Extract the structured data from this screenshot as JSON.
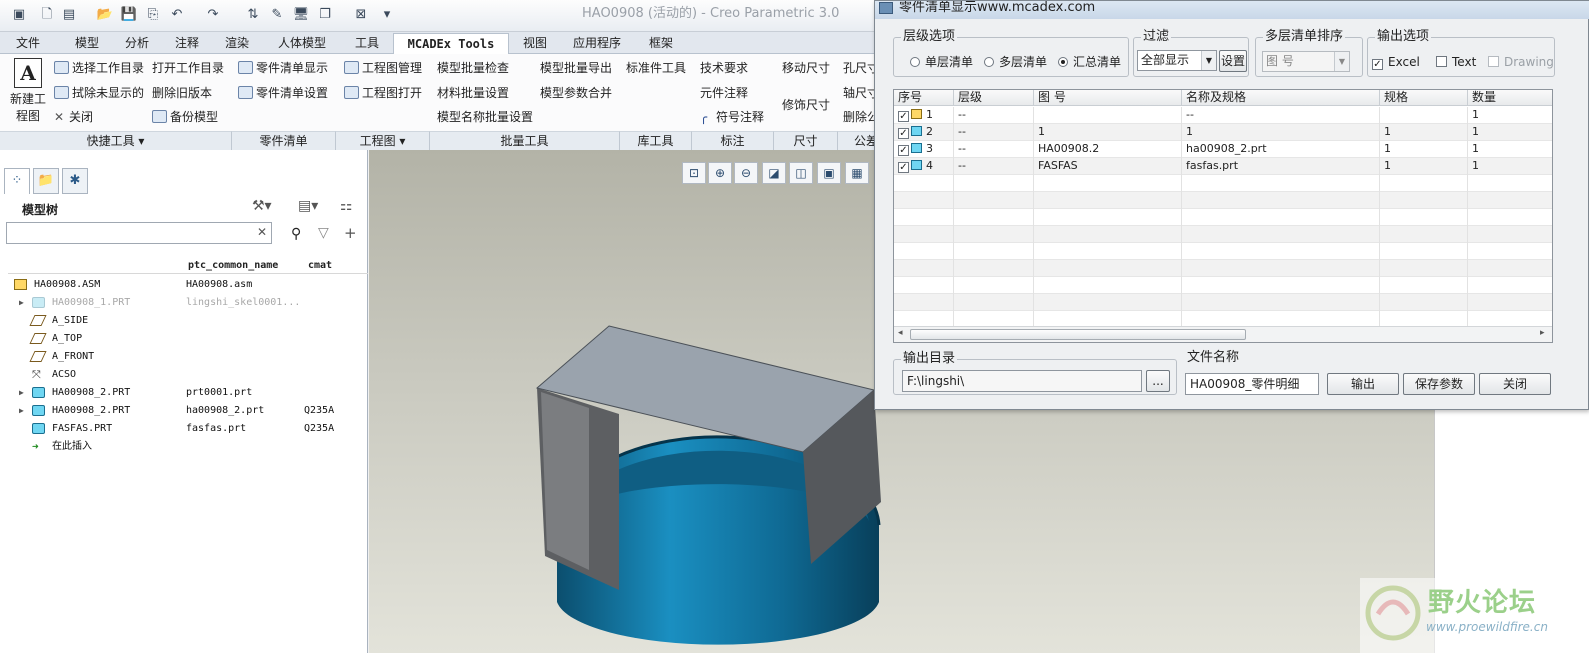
{
  "app": {
    "title": "HAO0908 (活动的) - Creo Parametric 3.0",
    "tabs": [
      "文件",
      "模型",
      "分析",
      "注释",
      "渲染",
      "人体模型",
      "工具",
      "MCADEx Tools",
      "视图",
      "应用程序",
      "框架"
    ],
    "active_tab": "MCADEx Tools"
  },
  "ribbon": {
    "new_drawing": "新建工程图",
    "quick": [
      "选择工作目录",
      "拭除未显示的",
      "关闭"
    ],
    "quick2": [
      "打开工作目录",
      "删除旧版本",
      "备份模型"
    ],
    "bom": [
      "零件清单显示",
      "零件清单设置"
    ],
    "drawing": [
      "工程图管理",
      "工程图打开"
    ],
    "batch": [
      "模型批量检查",
      "材料批量设置",
      "模型名称批量设置"
    ],
    "batch2": [
      "模型批量导出",
      "模型参数合并"
    ],
    "lib": [
      "标准件工具"
    ],
    "mark": [
      "技术要求",
      "元件注释",
      "符号注释"
    ],
    "dim": [
      "移动尺寸",
      "修饰尺寸"
    ],
    "misc": [
      "孔尺寸",
      "轴尺寸",
      "删除公"
    ],
    "groups": [
      "快捷工具",
      "零件清单",
      "工程图",
      "批量工具",
      "库工具",
      "标注",
      "尺寸",
      "公差"
    ]
  },
  "model_tree": {
    "title": "模型树",
    "columns": [
      "ptc_common_name",
      "cmat"
    ],
    "rows": [
      {
        "name": "HA00908.ASM",
        "common": "HA00908.asm",
        "cmat": "",
        "type": "asm",
        "dim": false
      },
      {
        "name": "HA00908_1.PRT",
        "common": "lingshi_skel0001...",
        "cmat": "",
        "type": "prt",
        "dim": true
      },
      {
        "name": "A_SIDE",
        "common": "",
        "cmat": "",
        "type": "plane",
        "dim": false
      },
      {
        "name": "A_TOP",
        "common": "",
        "cmat": "",
        "type": "plane",
        "dim": false
      },
      {
        "name": "A_FRONT",
        "common": "",
        "cmat": "",
        "type": "plane",
        "dim": false
      },
      {
        "name": "ACSO",
        "common": "",
        "cmat": "",
        "type": "csys",
        "dim": false
      },
      {
        "name": "HA00908_2.PRT",
        "common": "prt0001.prt",
        "cmat": "",
        "type": "prt",
        "dim": false
      },
      {
        "name": "HA00908_2.PRT",
        "common": "ha00908_2.prt",
        "cmat": "Q235A",
        "type": "prt",
        "dim": false
      },
      {
        "name": "FASFAS.PRT",
        "common": "fasfas.prt",
        "cmat": "Q235A",
        "type": "prt",
        "dim": false
      },
      {
        "name": "在此插入",
        "common": "",
        "cmat": "",
        "type": "ins",
        "dim": false
      }
    ]
  },
  "dialog": {
    "title": "零件清单显示www.mcadex.com",
    "level_group": "层级选项",
    "level_options": [
      "单层清单",
      "多层清单",
      "汇总清单"
    ],
    "level_selected": "汇总清单",
    "filter_group": "过滤",
    "filter_value": "全部显示",
    "settings_btn": "设置",
    "sort_group": "多层清单排序",
    "sort_value": "图 号",
    "output_group": "输出选项",
    "output_opts": [
      {
        "label": "Excel",
        "checked": true
      },
      {
        "label": "Text",
        "checked": false
      },
      {
        "label": "Drawing",
        "checked": false
      }
    ],
    "grid_headers": [
      "序号",
      "层级",
      "图 号",
      "名称及规格",
      "规格",
      "数量"
    ],
    "grid_rows": [
      [
        "1",
        "--",
        "",
        "--",
        "",
        "1"
      ],
      [
        "2",
        "--",
        "1",
        "1",
        "1",
        "1"
      ],
      [
        "3",
        "--",
        "HA00908.2",
        "ha00908_2.prt",
        "1",
        "1"
      ],
      [
        "4",
        "--",
        "FASFAS",
        "fasfas.prt",
        "1",
        "1"
      ]
    ],
    "out_dir_label": "输出目录",
    "out_dir_value": "F:\\lingshi\\",
    "browse_btn": "...",
    "file_name_label": "文件名称",
    "file_name_value": "HA00908_零件明细",
    "btn_output": "输出",
    "btn_save": "保存参数",
    "btn_close": "关闭"
  },
  "watermark": {
    "cn": "野火论坛",
    "url": "www.proewildfire.cn"
  }
}
